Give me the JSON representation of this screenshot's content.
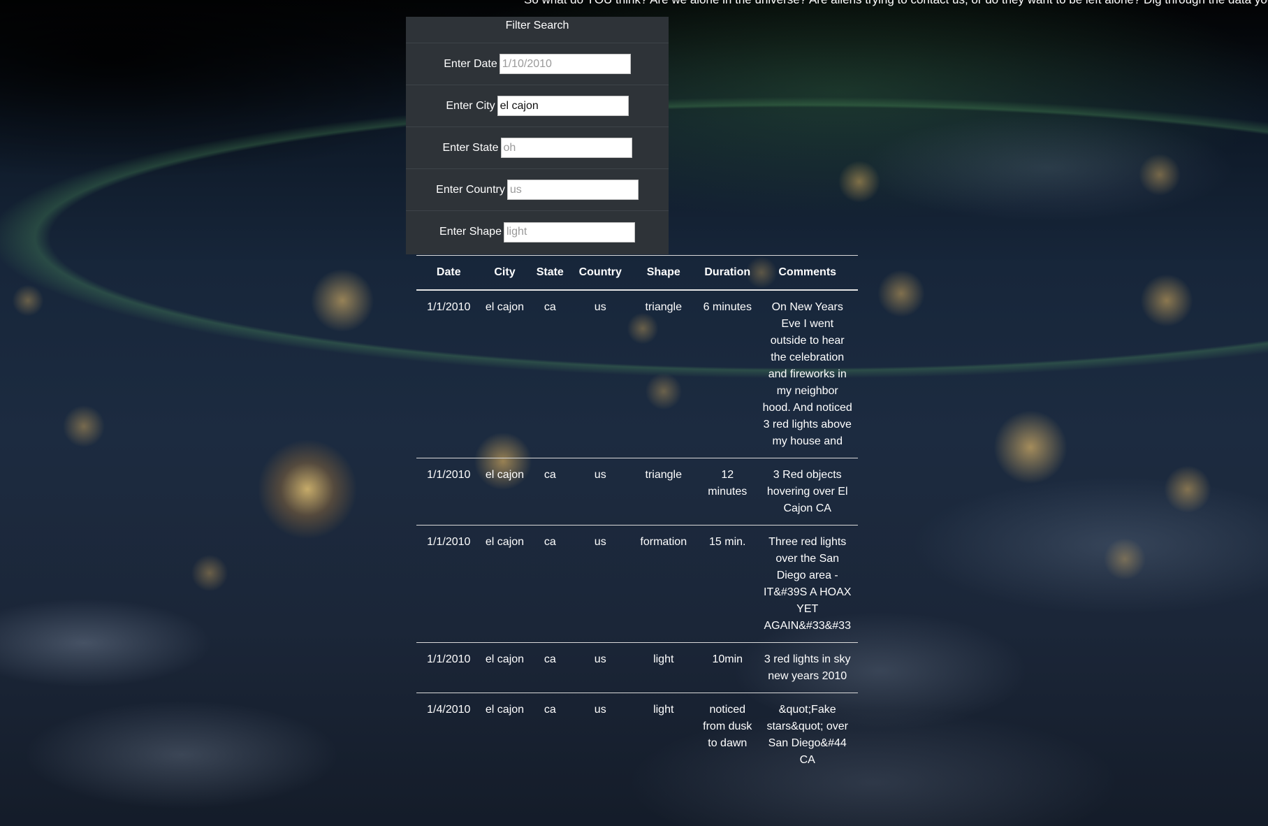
{
  "intro_text": "So what do YOU think? Are we alone in the universe? Are aliens trying to contact us, or do they want to be left alone? Dig through the data yourself, an",
  "filter": {
    "title": "Filter Search",
    "fields": [
      {
        "label": "Enter Date",
        "value": "",
        "placeholder": "1/10/2010"
      },
      {
        "label": "Enter City",
        "value": "el cajon",
        "placeholder": ""
      },
      {
        "label": "Enter State",
        "value": "",
        "placeholder": "oh"
      },
      {
        "label": "Enter Country",
        "value": "",
        "placeholder": "us"
      },
      {
        "label": "Enter Shape",
        "value": "",
        "placeholder": "light"
      }
    ]
  },
  "table": {
    "headers": [
      "Date",
      "City",
      "State",
      "Country",
      "Shape",
      "Duration",
      "Comments"
    ],
    "rows": [
      [
        "1/1/2010",
        "el cajon",
        "ca",
        "us",
        "triangle",
        "6 minutes",
        "On New Years Eve I went outside to hear the celebration and fireworks in my neighbor hood. And noticed 3 red lights above my house and"
      ],
      [
        "1/1/2010",
        "el cajon",
        "ca",
        "us",
        "triangle",
        "12 minutes",
        "3 Red objects hovering over El Cajon CA"
      ],
      [
        "1/1/2010",
        "el cajon",
        "ca",
        "us",
        "formation",
        "15 min.",
        "Three red lights over the San Diego area - IT&#39S A HOAX YET AGAIN&#33&#33"
      ],
      [
        "1/1/2010",
        "el cajon",
        "ca",
        "us",
        "light",
        "10min",
        "3 red lights in sky new years 2010"
      ],
      [
        "1/4/2010",
        "el cajon",
        "ca",
        "us",
        "light",
        "noticed from dusk to dawn",
        "&quot;Fake stars&quot; over San Diego&#44 CA"
      ]
    ]
  },
  "colors": {
    "panel_bg": "#2e3338",
    "text": "#ffffff",
    "table_border": "#d9d9d9"
  }
}
